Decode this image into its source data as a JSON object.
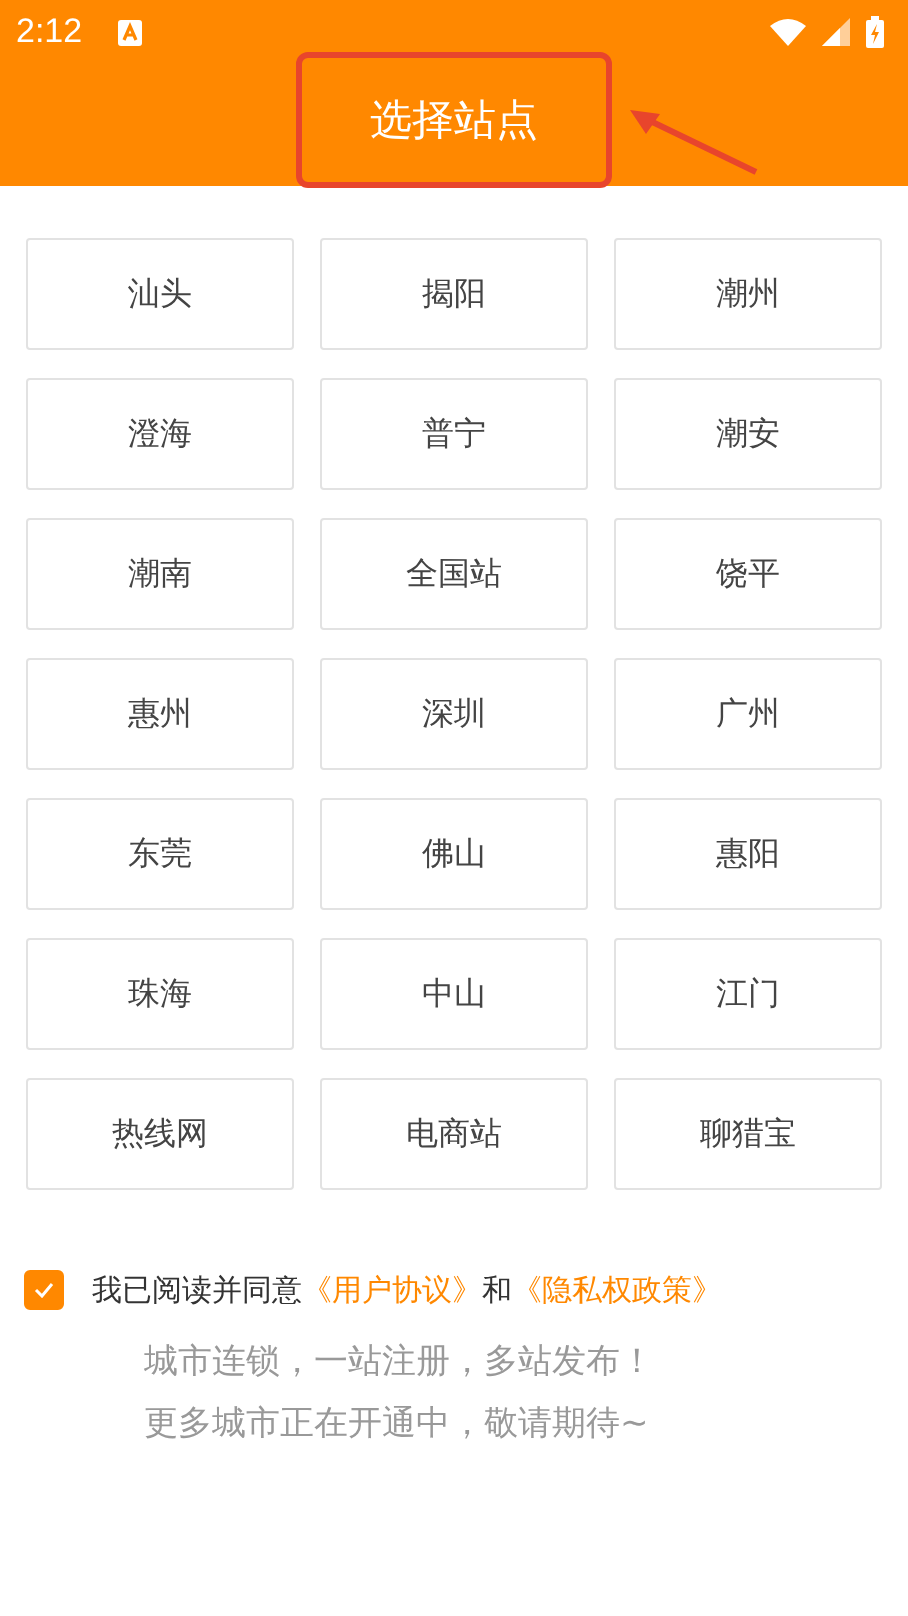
{
  "status_bar": {
    "time": "2:12"
  },
  "header": {
    "title": "选择站点",
    "highlighted": true
  },
  "stations": [
    {
      "label": "汕头"
    },
    {
      "label": "揭阳"
    },
    {
      "label": "潮州"
    },
    {
      "label": "澄海"
    },
    {
      "label": "普宁"
    },
    {
      "label": "潮安"
    },
    {
      "label": "潮南"
    },
    {
      "label": "全国站"
    },
    {
      "label": "饶平"
    },
    {
      "label": "惠州"
    },
    {
      "label": "深圳"
    },
    {
      "label": "广州"
    },
    {
      "label": "东莞"
    },
    {
      "label": "佛山"
    },
    {
      "label": "惠阳"
    },
    {
      "label": "珠海"
    },
    {
      "label": "中山"
    },
    {
      "label": "江门"
    },
    {
      "label": "热线网"
    },
    {
      "label": "电商站"
    },
    {
      "label": "聊猎宝"
    }
  ],
  "agreement": {
    "checked": true,
    "parts": [
      {
        "kind": "text",
        "text": "我已阅读并同意"
      },
      {
        "kind": "link",
        "text": "《用户协议》"
      },
      {
        "kind": "text",
        "text": "和"
      },
      {
        "kind": "link",
        "text": "《隐私权政策》"
      }
    ]
  },
  "notice": [
    "城市连锁，一站注册，多站发布！",
    "更多城市正在开通中，敬请期待~"
  ]
}
